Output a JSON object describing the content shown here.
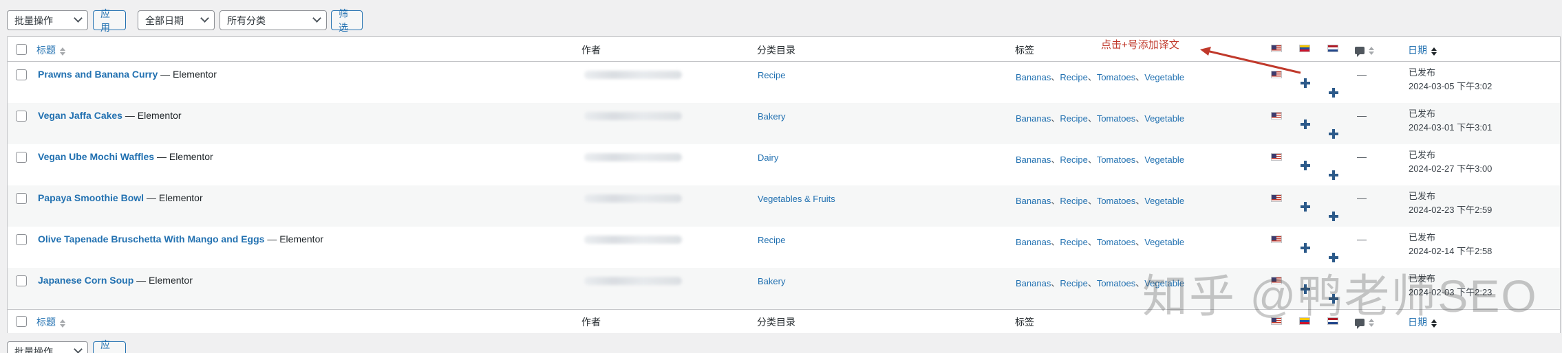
{
  "toolbar_top": {
    "bulk_action": "批量操作",
    "apply": "应用",
    "date_filter": "全部日期",
    "category_filter": "所有分类",
    "filter_button": "筛选"
  },
  "columns": {
    "title": "标题",
    "author": "作者",
    "categories": "分类目录",
    "tags": "标签",
    "date": "日期"
  },
  "rows": [
    {
      "title": "Prawns and Banana Curry",
      "suffix": " — Elementor",
      "category": "Recipe",
      "tags": [
        "Bananas",
        "Recipe",
        "Tomatoes",
        "Vegetable"
      ],
      "comments": "—",
      "status": "已发布",
      "date": "2024-03-05 下午3:02"
    },
    {
      "title": "Vegan Jaffa Cakes",
      "suffix": " — Elementor",
      "category": "Bakery",
      "tags": [
        "Bananas",
        "Recipe",
        "Tomatoes",
        "Vegetable"
      ],
      "comments": "—",
      "status": "已发布",
      "date": "2024-03-01 下午3:01"
    },
    {
      "title": "Vegan Ube Mochi Waffles",
      "suffix": " — Elementor",
      "category": "Dairy",
      "tags": [
        "Bananas",
        "Recipe",
        "Tomatoes",
        "Vegetable"
      ],
      "comments": "—",
      "status": "已发布",
      "date": "2024-02-27 下午3:00"
    },
    {
      "title": "Papaya Smoothie Bowl",
      "suffix": " — Elementor",
      "category": "Vegetables & Fruits",
      "tags": [
        "Bananas",
        "Recipe",
        "Tomatoes",
        "Vegetable"
      ],
      "comments": "—",
      "status": "已发布",
      "date": "2024-02-23 下午2:59"
    },
    {
      "title": "Olive Tapenade Bruschetta With Mango and Eggs",
      "suffix": " — Elementor",
      "category": "Recipe",
      "tags": [
        "Bananas",
        "Recipe",
        "Tomatoes",
        "Vegetable"
      ],
      "comments": "—",
      "status": "已发布",
      "date": "2024-02-14 下午2:58"
    },
    {
      "title": "Japanese Corn Soup",
      "suffix": " — Elementor",
      "category": "Bakery",
      "tags": [
        "Bananas",
        "Recipe",
        "Tomatoes",
        "Vegetable"
      ],
      "comments": "",
      "status": "已发布",
      "date": "2024-02-03 下午2:23"
    }
  ],
  "tag_separator": "、",
  "annotation": "点击+号添加译文",
  "watermark": "知乎 @鸭老师SEO",
  "toolbar_bottom": {
    "bulk_action": "批量操作",
    "apply": "应用"
  },
  "colors": {
    "link": "#2271b1",
    "annotation": "#c0392b",
    "plus": "#2c5a8a"
  },
  "icons": [
    "flag-us-icon",
    "flag-ve-icon",
    "flag-nl-icon",
    "comment-icon",
    "plus-icon",
    "sort-icon"
  ]
}
